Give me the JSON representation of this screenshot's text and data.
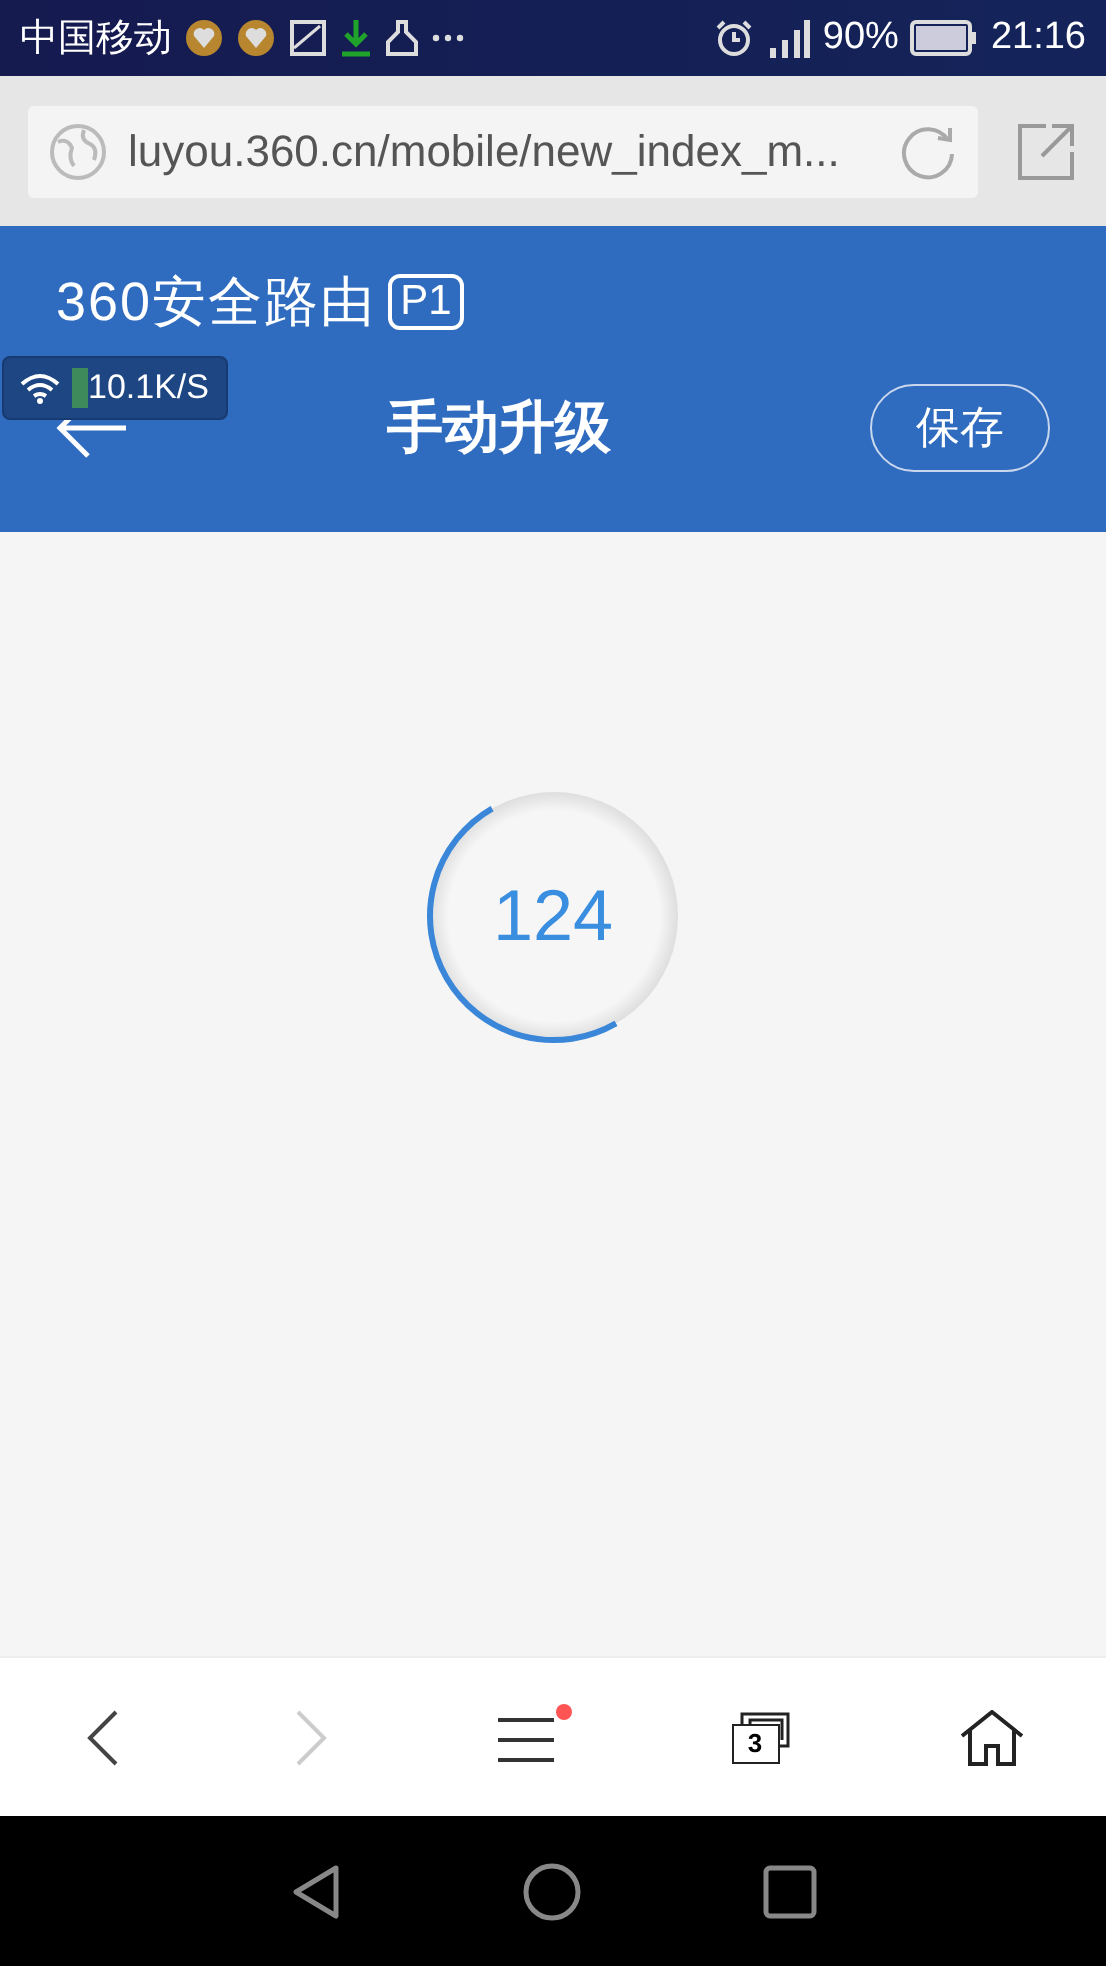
{
  "status_bar": {
    "carrier": "中国移动",
    "battery": "90%",
    "time": "21:16"
  },
  "browser": {
    "url": "luyou.360.cn/mobile/new_index_m..."
  },
  "header": {
    "logo": "360安全路由",
    "logo_badge": "P1",
    "title": "手动升级",
    "save_button": "保存"
  },
  "speed_overlay": {
    "speed": "10.1K/S"
  },
  "countdown": {
    "value": "124",
    "level": 0.5
  },
  "toolbar": {
    "back_disabled": false,
    "forward_disabled": true,
    "menu_notification": true,
    "tab_count": "3"
  }
}
